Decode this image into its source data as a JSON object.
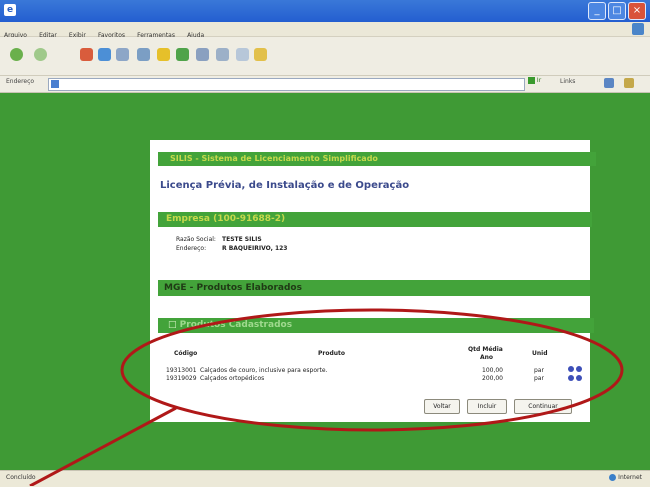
{
  "window": {
    "title": "",
    "icon": "window-app-icon"
  },
  "menu": {
    "items": [
      "Arquivo",
      "Editar",
      "Exibir",
      "Favoritos",
      "Ferramentas",
      "Ajuda"
    ]
  },
  "address": {
    "label": "Endereço",
    "go_label": "Ir",
    "links_label": "Links"
  },
  "banner": {
    "title": "SILIS - Sistema de Licenciamento Simplificado"
  },
  "page": {
    "title": "Licença Prévia, de Instalação e de Operação"
  },
  "empresa": {
    "header": "Empresa (100-91688-2)",
    "razao_label": "Razão Social:",
    "razao_value": "TESTE SILIS",
    "endereco_label": "Endereço:",
    "endereco_value": "R BAQUEIRIVO, 123"
  },
  "sections": {
    "produtos_elaborados": "MGE - Produtos Elaborados",
    "produtos_cadastrados": "Produtos Cadastrados"
  },
  "table": {
    "headers": {
      "codigo": "Código",
      "produto": "Produto",
      "qtd": "Qtd Média",
      "qtd_2": "Ano",
      "unid": "Unid"
    },
    "rows": [
      {
        "codigo": "19313001",
        "produto": "Calçados de couro, inclusive para esporte.",
        "qtd": "100,00",
        "unid": "par"
      },
      {
        "codigo": "19319029",
        "produto": "Calçados ortopédicos",
        "qtd": "200,00",
        "unid": "par"
      }
    ]
  },
  "buttons": {
    "voltar": "Voltar",
    "incluir": "Incluir",
    "continuar": "Continuar"
  },
  "status": {
    "left": "Concluído",
    "zone": "Internet"
  },
  "colors": {
    "page_bg": "#3f9a35",
    "section_bar": "#43a33a",
    "title_text": "#3b4a8c",
    "annotation": "#b01818"
  }
}
